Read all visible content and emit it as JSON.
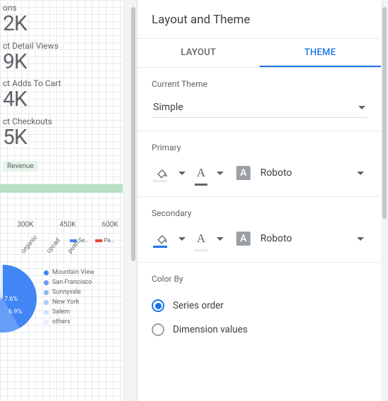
{
  "canvas": {
    "metrics": [
      {
        "label": "ons",
        "value": "2K"
      },
      {
        "label": "ct Detail Views",
        "value": "9K"
      },
      {
        "label": "ct Adds To Cart",
        "value": "4K"
      },
      {
        "label": "ct Checkouts",
        "value": "5K"
      }
    ],
    "revenue_label": "Revenue",
    "axis_ticks": [
      "300K",
      "450K",
      "600K"
    ],
    "mini_series": [
      {
        "label": "Se…",
        "color": "#4285f4"
      },
      {
        "label": "Pa…",
        "color": "#ea4335"
      }
    ],
    "category_labels": [
      "organic",
      "cpcad",
      "push"
    ],
    "pie": {
      "percents": [
        "7.6%",
        "6.9%"
      ],
      "legend": [
        {
          "label": "Mountain View",
          "color": "#4285f4"
        },
        {
          "label": "San Francisco",
          "color": "#669df6"
        },
        {
          "label": "Sunnyvale",
          "color": "#8ab4f8"
        },
        {
          "label": "New York",
          "color": "#aecbfa"
        },
        {
          "label": "Salem",
          "color": "#cfe2ff"
        },
        {
          "label": "others",
          "color": "#e8f0fe"
        }
      ]
    }
  },
  "panel": {
    "title": "Layout and Theme",
    "tabs": {
      "layout": "LAYOUT",
      "theme": "THEME"
    },
    "current_theme": {
      "section_label": "Current Theme",
      "value": "Simple"
    },
    "primary": {
      "section_label": "Primary",
      "fill_color": "#ffffff",
      "text_color": "#5f6368",
      "font_badge": "A",
      "font_name": "Roboto"
    },
    "secondary": {
      "section_label": "Secondary",
      "fill_color": "#1a73e8",
      "text_color": "#ffffff",
      "font_badge": "A",
      "font_name": "Roboto"
    },
    "color_by": {
      "section_label": "Color By",
      "options": {
        "series": "Series order",
        "dimension": "Dimension values"
      },
      "selected": "series"
    }
  },
  "chart_data": [
    {
      "type": "table",
      "note": "Partially visible KPI tiles (left-cropped)",
      "rows": [
        {
          "metric_suffix": "ons",
          "value_text": "2K"
        },
        {
          "metric_suffix": "ct Detail Views",
          "value_text": "9K"
        },
        {
          "metric_suffix": "ct Adds To Cart",
          "value_text": "4K"
        },
        {
          "metric_suffix": "ct Checkouts",
          "value_text": "5K"
        }
      ]
    },
    {
      "type": "bar",
      "title": "Revenue",
      "orientation": "horizontal",
      "x_ticks_visible": [
        300000,
        450000,
        600000
      ],
      "series": [
        {
          "name": "Revenue",
          "values": [
            600000
          ]
        }
      ],
      "note": "Single green bar, axis shown 300K–600K"
    },
    {
      "type": "bar",
      "note": "Grouped column chart, data area cropped out; only categories and legend visible.",
      "categories": [
        "organic",
        "cpcad",
        "push"
      ],
      "series": [
        {
          "name": "Se…",
          "color": "#4285f4",
          "values": [
            null,
            null,
            null
          ]
        },
        {
          "name": "Pa…",
          "color": "#ea4335",
          "values": [
            null,
            null,
            null
          ]
        }
      ]
    },
    {
      "type": "pie",
      "title": "",
      "slices": [
        {
          "label": "Mountain View",
          "value_pct": null,
          "color": "#4285f4"
        },
        {
          "label": "San Francisco",
          "value_pct": null,
          "color": "#669df6"
        },
        {
          "label": "Sunnyvale",
          "value_pct": 7.6,
          "color": "#8ab4f8"
        },
        {
          "label": "New York",
          "value_pct": 6.9,
          "color": "#aecbfa"
        },
        {
          "label": "Salem",
          "value_pct": null,
          "color": "#cfe2ff"
        },
        {
          "label": "others",
          "value_pct": null,
          "color": "#e8f0fe"
        }
      ],
      "note": "Only two slice percents are legible (7.6%, 6.9%). Chart is partially cropped on the left."
    }
  ]
}
